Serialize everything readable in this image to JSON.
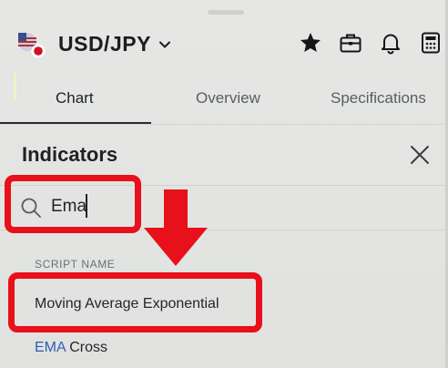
{
  "header": {
    "symbol": "USD/JPY",
    "icons": [
      "flag-icon",
      "chevron-down-icon",
      "star-icon",
      "briefcase-icon",
      "bell-icon",
      "calculator-icon"
    ]
  },
  "tabs": [
    {
      "label": "Chart",
      "active": true
    },
    {
      "label": "Overview",
      "active": false
    },
    {
      "label": "Specifications",
      "active": false
    }
  ],
  "panel": {
    "title": "Indicators",
    "search_value": "Ema",
    "section_label": "SCRIPT NAME",
    "results": [
      {
        "text": "Moving Average Exponential"
      },
      {
        "highlight": "EMA",
        "rest": " Cross"
      }
    ]
  },
  "colors": {
    "annotation_red": "#e8101a",
    "highlight_blue": "#2f5fb0",
    "background": "#e4e5e3"
  }
}
